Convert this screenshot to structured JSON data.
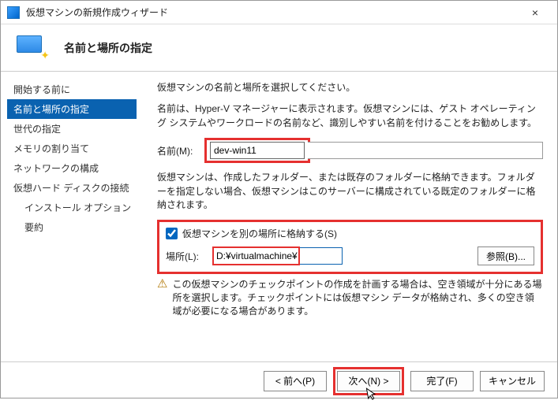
{
  "window": {
    "title": "仮想マシンの新規作成ウィザード",
    "close_icon": "×"
  },
  "header": {
    "title": "名前と場所の指定"
  },
  "sidebar": {
    "steps": [
      "開始する前に",
      "名前と場所の指定",
      "世代の指定",
      "メモリの割り当て",
      "ネットワークの構成",
      "仮想ハード ディスクの接続",
      "インストール オプション",
      "要約"
    ],
    "active_index": 1,
    "sub_indices": [
      6,
      7
    ]
  },
  "main": {
    "p1": "仮想マシンの名前と場所を選択してください。",
    "p2": "名前は、Hyper-V マネージャーに表示されます。仮想マシンには、ゲスト オペレーティング システムやワークロードの名前など、識別しやすい名前を付けることをお勧めします。",
    "name_label": "名前(M):",
    "name_value": "dev-win11",
    "p3": "仮想マシンは、作成したフォルダー、または既存のフォルダーに格納できます。フォルダーを指定しない場合、仮想マシンはこのサーバーに構成されている既定のフォルダーに格納されます。",
    "checkbox_label": "仮想マシンを別の場所に格納する(S)",
    "checkbox_checked": true,
    "location_label": "場所(L):",
    "location_value": "D:¥virtualmachine¥",
    "browse_label": "参照(B)...",
    "warning_text": "この仮想マシンのチェックポイントの作成を計画する場合は、空き領域が十分にある場所を選択します。チェックポイントには仮想マシン データが格納され、多くの空き領域が必要になる場合があります。"
  },
  "footer": {
    "prev": "< 前へ(P)",
    "next": "次へ(N) >",
    "finish": "完了(F)",
    "cancel": "キャンセル"
  }
}
